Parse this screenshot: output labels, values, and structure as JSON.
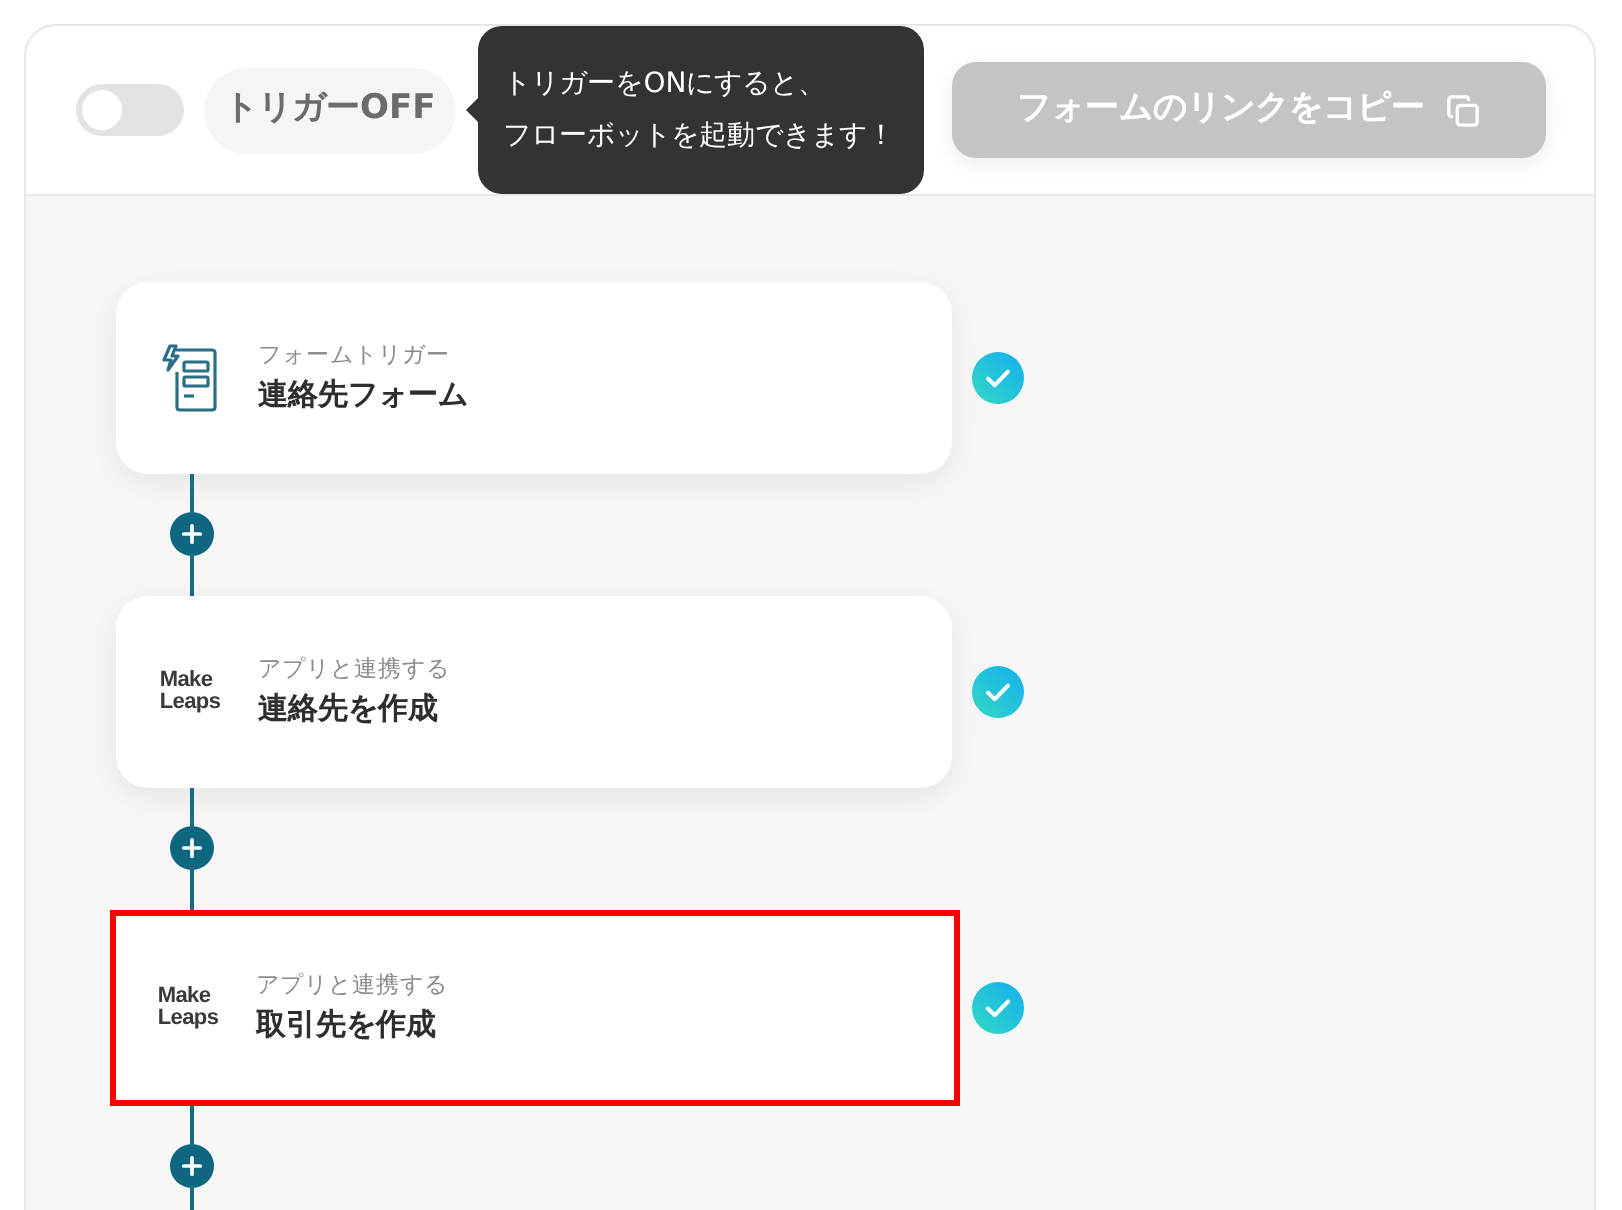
{
  "trigger": {
    "on": false,
    "label": "トリガーOFF"
  },
  "tooltip": {
    "lines": [
      "トリガーをONにすると、",
      "フローボットを起動できます！"
    ]
  },
  "copy_link_button": {
    "label": "フォームのリンクをコピー",
    "disabled": true
  },
  "steps": [
    {
      "kind": "form",
      "caption": "フォームトリガー",
      "title": "連絡先フォーム",
      "done": true,
      "highlighted": false
    },
    {
      "kind": "app",
      "logo": [
        "Make",
        "Leaps"
      ],
      "caption": "アプリと連携する",
      "title": "連絡先を作成",
      "done": true,
      "highlighted": false
    },
    {
      "kind": "app",
      "logo": [
        "Make",
        "Leaps"
      ],
      "caption": "アプリと連携する",
      "title": "取引先を作成",
      "done": true,
      "highlighted": true
    }
  ]
}
